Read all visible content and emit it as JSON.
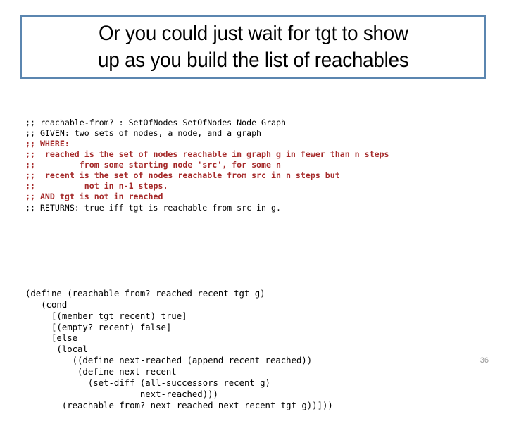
{
  "slide": {
    "title": {
      "lines": [
        "Or you could just wait for tgt to show",
        "up as you build the list of reachables"
      ],
      "border_color": "#5B86B0"
    },
    "page_number": "36",
    "colors": {
      "background": "#ffffff",
      "title_text": "#000000",
      "title_border": "#5B86B0",
      "comment_black": "#000000",
      "comment_red": "#A52A2A",
      "code_text": "#000000",
      "page_number": "#969696"
    }
  },
  "comment_block": {
    "lines": [
      {
        "text": ";; reachable-from? : SetOfNodes SetOfNodes Node Graph",
        "color": "black"
      },
      {
        "text": ";; GIVEN: two sets of nodes, a node, and a graph",
        "color": "black"
      },
      {
        "text": ";; WHERE:",
        "color": "red"
      },
      {
        "text": ";;  reached is the set of nodes reachable in graph g in fewer than n steps",
        "color": "red"
      },
      {
        "text": ";;         from some starting node 'src', for some n",
        "color": "red"
      },
      {
        "text": ";;  recent is the set of nodes reachable from src in n steps but",
        "color": "red"
      },
      {
        "text": ";;          not in n-1 steps.",
        "color": "red"
      },
      {
        "text": ";; AND tgt is not in reached",
        "color": "red"
      },
      {
        "text": ";; RETURNS: true iff tgt is reachable from src in g.",
        "color": "black"
      }
    ]
  },
  "code_block": {
    "lines": [
      "(define (reachable-from? reached recent tgt g)",
      "   (cond",
      "     [(member tgt recent) true]",
      "     [(empty? recent) false]",
      "     [else",
      "      (local",
      "         ((define next-reached (append recent reached))",
      "          (define next-recent",
      "            (set-diff (all-successors recent g)",
      "                      next-reached)))",
      "       (reachable-from? next-reached next-recent tgt g))]))"
    ]
  }
}
